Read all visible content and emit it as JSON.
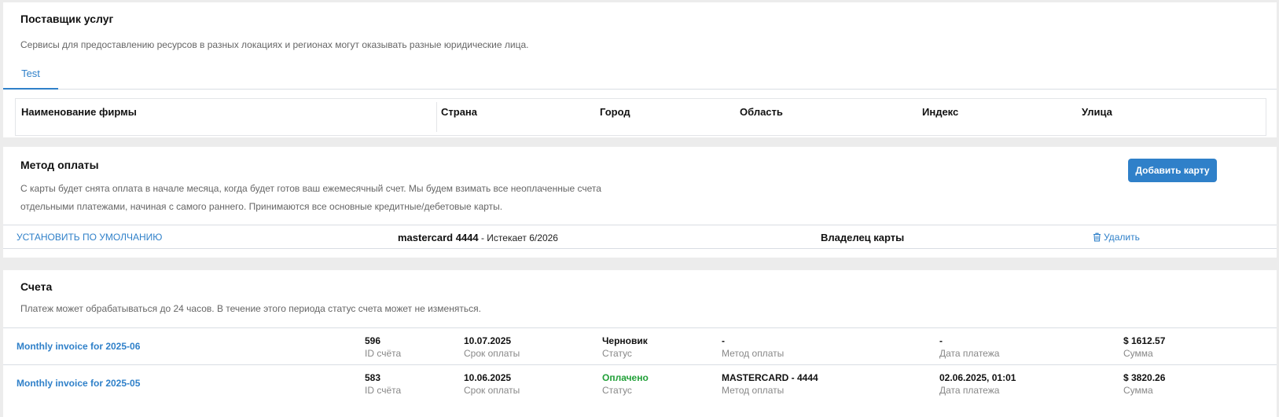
{
  "provider": {
    "title": "Поставщик услуг",
    "description": "Сервисы для предоставлению ресурсов в разных локациях и регионах могут оказывать разные юридические лица.",
    "tabs": [
      {
        "label": "Test"
      }
    ],
    "columns": [
      "Наименование фирмы",
      "Страна",
      "Город",
      "Область",
      "Индекс",
      "Улица"
    ]
  },
  "payment": {
    "title": "Метод оплаты",
    "description": "С карты будет снята оплата в начале месяца, когда будет готов ваш ежемесячный счет. Мы будем взимать все неоплаченные счета отдельными платежами, начиная с самого раннего. Принимаются все основные кредитные/дебетовые карты.",
    "add_card_label": "Добавить карту",
    "card": {
      "set_default_label": "УСТАНОВИТЬ ПО УМОЛЧАНИЮ",
      "brand": "mastercard 4444",
      "expires": " - Истекает 6/2026",
      "owner_label": "Владелец карты",
      "delete_label": "Удалить",
      "delete_icon": "trash-icon"
    }
  },
  "invoices": {
    "title": "Счета",
    "description": "Платеж может обрабатываться до 24 часов. В течение этого периода статус счета может не изменяться.",
    "labels": {
      "id": "ID счёта",
      "due": "Срок оплаты",
      "status": "Статус",
      "method": "Метод оплаты",
      "paid_date": "Дата платежа",
      "amount": "Сумма"
    },
    "rows": [
      {
        "title": "Monthly invoice for 2025-06",
        "id": "596",
        "due": "10.07.2025",
        "status": "Черновик",
        "method": "-",
        "paid_date": "-",
        "amount": "$ 1612.57"
      },
      {
        "title": "Monthly invoice for 2025-05",
        "id": "583",
        "due": "10.06.2025",
        "status": "Оплачено",
        "status_color": "#21a038",
        "method": "MASTERCARD - 4444",
        "paid_date": "02.06.2025, 01:01",
        "amount": "$ 3820.26"
      }
    ]
  },
  "colors": {
    "accent": "#2f80c9",
    "success": "#21a038",
    "background": "#ececec"
  }
}
